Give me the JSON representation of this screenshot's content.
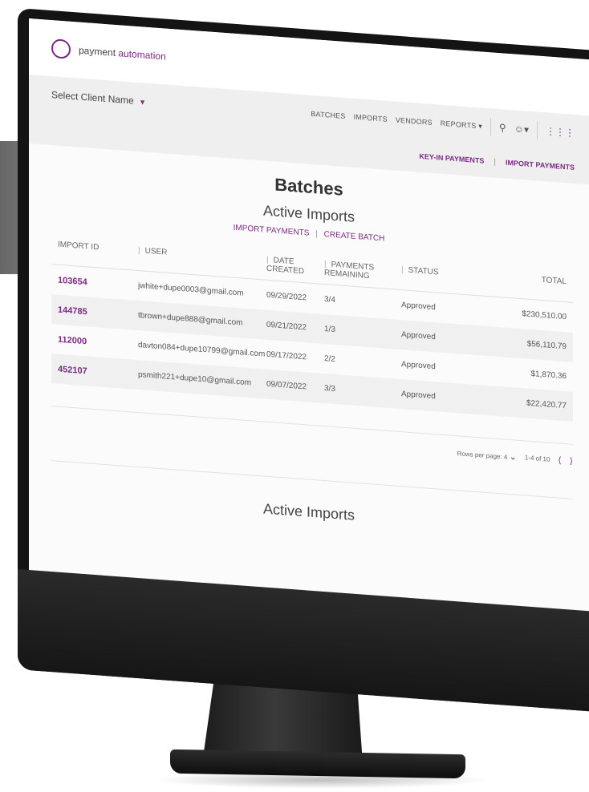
{
  "app": {
    "brand_light": "payment",
    "brand_bold": "automation"
  },
  "nav": {
    "client_select": "Select Client Name",
    "links": [
      "BATCHES",
      "IMPORTS",
      "VENDORS",
      "REPORTS"
    ]
  },
  "actions": {
    "key_in": "KEY-IN PAYMENTS",
    "import": "IMPORT PAYMENTS"
  },
  "page": {
    "title": "Batches",
    "section_title": "Active Imports",
    "sub_link_import": "IMPORT PAYMENTS",
    "sub_link_create": "CREATE BATCH"
  },
  "table": {
    "headers": [
      "IMPORT ID",
      "USER",
      "DATE CREATED",
      "PAYMENTS REMAINING",
      "STATUS",
      "TOTAL"
    ],
    "rows": [
      {
        "id": "103654",
        "user": "jwhite+dupe0003@gmail.com",
        "date": "09/29/2022",
        "remaining": "3/4",
        "status": "Approved",
        "total": "$230,510.00"
      },
      {
        "id": "144785",
        "user": "tbrown+dupe888@gmail.com",
        "date": "09/21/2022",
        "remaining": "1/3",
        "status": "Approved",
        "total": "$56,110.79"
      },
      {
        "id": "112000",
        "user": "davton084+dupe10799@gmail.com",
        "date": "09/17/2022",
        "remaining": "2/2",
        "status": "Approved",
        "total": "$1,870.36"
      },
      {
        "id": "452107",
        "user": "psmith221+dupe10@gmail.com",
        "date": "09/07/2022",
        "remaining": "3/3",
        "status": "Approved",
        "total": "$22,420.77"
      }
    ]
  },
  "pager": {
    "rows_per_page_label": "Rows per page: 4",
    "range": "1-4 of 10"
  },
  "second_section_title": "Active Imports",
  "colors": {
    "accent": "#7a2a82",
    "bezel": "#141414"
  },
  "icons": [
    "logo-icon",
    "caret-down-icon",
    "search-icon",
    "user-icon",
    "apps-grid-icon",
    "chevron-left-icon",
    "chevron-right-icon"
  ]
}
